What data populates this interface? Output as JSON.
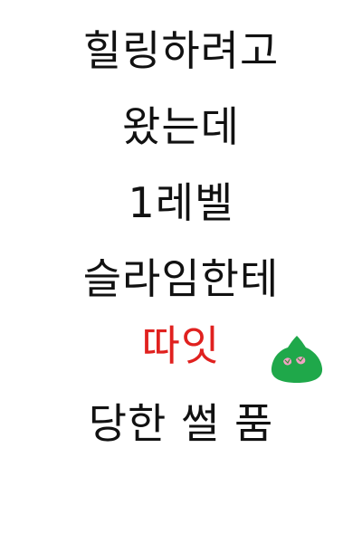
{
  "lines": [
    {
      "text": "힐링하려고"
    },
    {
      "text": "왔는데"
    },
    {
      "text": "1레벨"
    },
    {
      "text": "슬라임한테"
    },
    {
      "text": "따잇",
      "color": "#e0211f"
    },
    {
      "text": "당한 썰 품"
    }
  ],
  "colors": {
    "text": "#111111",
    "highlight": "#e0211f",
    "slime_body": "#1fa84a",
    "slime_face": "#f0a3c4"
  },
  "icons": {
    "slime": "slime-icon"
  }
}
